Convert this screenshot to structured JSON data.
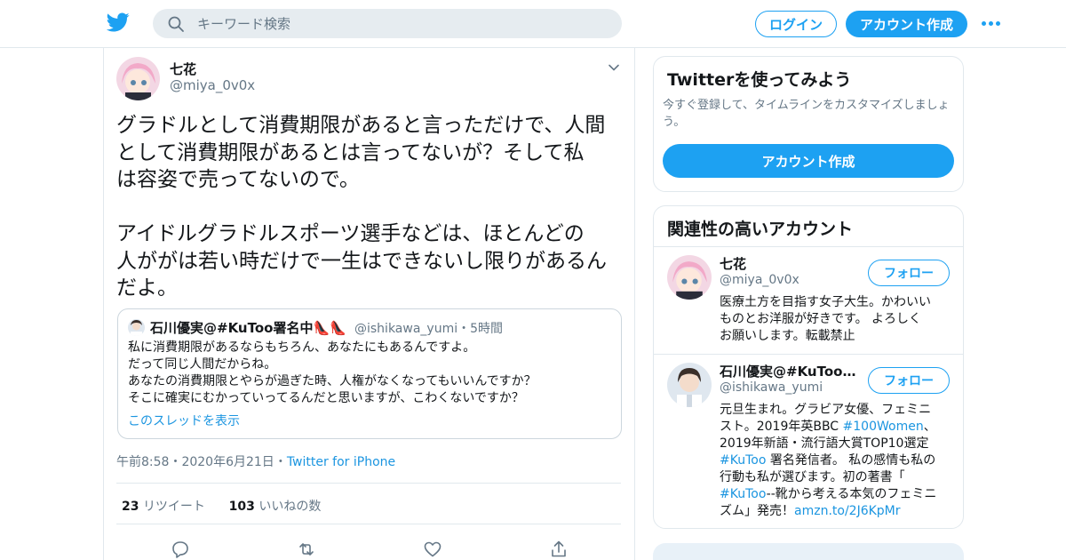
{
  "header": {
    "search_placeholder": "キーワード検索",
    "login_label": "ログイン",
    "signup_label": "アカウント作成",
    "accent_color": "#1da1f2"
  },
  "tweet": {
    "user_name": "七花",
    "user_handle": "@miya_0v0x",
    "text": "グラドルとして消費期限があると言っただけで、人間\nとして消費期限があるとは言ってないが？そして私\nは容姿で売ってないので。\n\nアイドルグラドルスポーツ選手などは、ほとんどの\n人ががは若い時だけで一生はできないし限りがあるん\nだよ。",
    "quoted": {
      "user_name": "石川優実@#KuToo署名中👠👠",
      "handle_time": "@ishikawa_yumi・5時間",
      "text": "私に消費期限があるならもちろん、あなたにもあるんですよ。\nだって同じ人間だからね。\nあなたの消費期限とやらが過ぎた時、人権がなくなってもいいんですか？\nそこに確実にむかっていってるんだと思いますが、こわくないですか？",
      "show_thread_label": "このスレッドを表示"
    },
    "time": "午前8:58",
    "sep1": "・",
    "date": "2020年6月21日",
    "sep2": "・",
    "source": "Twitter for iPhone",
    "retweet_count": "23",
    "retweet_label": "リツイート",
    "like_count": "103",
    "like_label": "いいねの数"
  },
  "sidebar": {
    "signup_card": {
      "title": "Twitterを使ってみよう",
      "description": "今すぐ登録して、タイムラインをカスタマイズしましょう。",
      "cta_label": "アカウント作成"
    },
    "related": {
      "title": "関連性の高いアカウント",
      "follow_label": "フォロー",
      "accounts": [
        {
          "name": "七花",
          "handle": "@miya_0v0x",
          "bio": "医療土方を目指す女子大生。かわいい\nものとお洋服が好きです。 よろしく\nお願いします。転載禁止"
        },
        {
          "name": "石川優実@#KuToo署名中👠👠",
          "handle": "@ishikawa_yumi",
          "bio_1": "元旦生まれ。グラビア女優、フェミニ\nスト。2019年英BBC ",
          "bio_tag1": "#100Women",
          "bio_2": "、\n2019年新語・流行語大賞TOP10選定\n",
          "bio_tag2": "#KuToo",
          "bio_3": " 署名発信者。 私の感情も私の\n行動も私が選びます。初の著書「\n",
          "bio_tag3": "#KuToo",
          "bio_4": "--靴から考える本気のフェミニ\nズム」発売！",
          "bio_link": "amzn.to/2J6KpMr"
        }
      ]
    }
  }
}
